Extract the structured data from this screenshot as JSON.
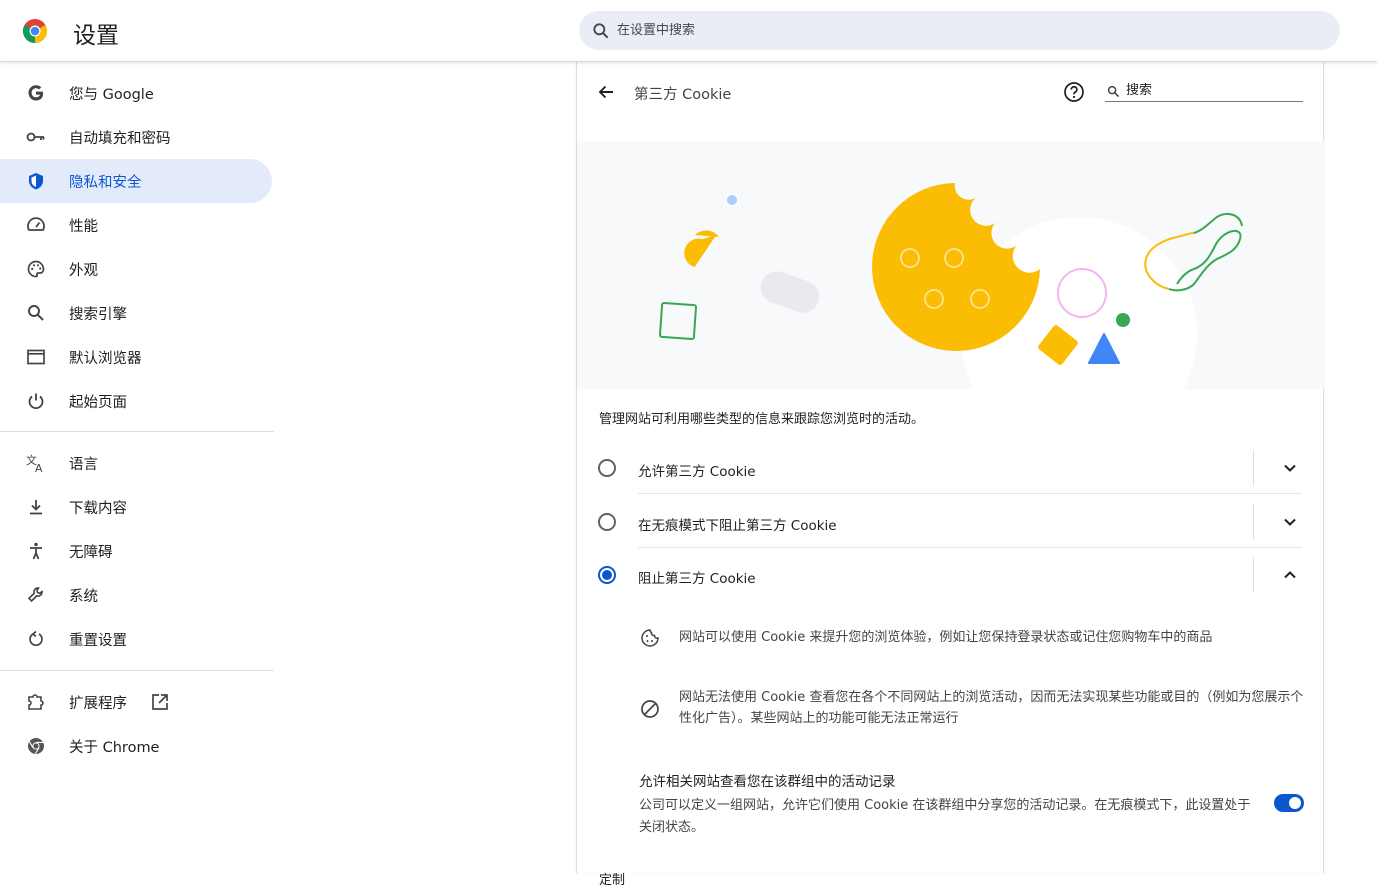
{
  "app": {
    "title": "设置"
  },
  "search": {
    "placeholder": "在设置中搜索"
  },
  "sidebar": {
    "items": [
      {
        "label": "您与 Google",
        "icon": "google-g-icon"
      },
      {
        "label": "自动填充和密码",
        "icon": "key-icon"
      },
      {
        "label": "隐私和安全",
        "icon": "shield-icon",
        "active": true
      },
      {
        "label": "性能",
        "icon": "speedometer-icon"
      },
      {
        "label": "外观",
        "icon": "palette-icon"
      },
      {
        "label": "搜索引擎",
        "icon": "search-icon"
      },
      {
        "label": "默认浏览器",
        "icon": "browser-window-icon"
      },
      {
        "label": "起始页面",
        "icon": "power-icon"
      },
      {
        "label": "语言",
        "icon": "translate-icon"
      },
      {
        "label": "下载内容",
        "icon": "download-icon"
      },
      {
        "label": "无障碍",
        "icon": "accessibility-icon"
      },
      {
        "label": "系统",
        "icon": "wrench-icon"
      },
      {
        "label": "重置设置",
        "icon": "reset-icon"
      },
      {
        "label": "扩展程序",
        "icon": "puzzle-icon",
        "external": true
      },
      {
        "label": "关于 Chrome",
        "icon": "chrome-icon"
      }
    ]
  },
  "page": {
    "title": "第三方 Cookie",
    "search_placeholder": "搜索",
    "description": "管理网站可利用哪些类型的信息来跟踪您浏览时的活动。",
    "options": [
      {
        "label": "允许第三方 Cookie",
        "selected": false,
        "expanded": false
      },
      {
        "label": "在无痕模式下阻止第三方 Cookie",
        "selected": false,
        "expanded": false
      },
      {
        "label": "阻止第三方 Cookie",
        "selected": true,
        "expanded": true
      }
    ],
    "details": [
      {
        "icon": "cookie-icon",
        "text": "网站可以使用 Cookie 来提升您的浏览体验，例如让您保持登录状态或记住您购物车中的商品"
      },
      {
        "icon": "block-icon",
        "text": "网站无法使用 Cookie 查看您在各个不同网站上的浏览活动，因而无法实现某些功能或目的（例如为您展示个性化广告）。某些网站上的功能可能无法正常运行"
      }
    ],
    "related_sites": {
      "title": "允许相关网站查看您在该群组中的活动记录",
      "description": "公司可以定义一组网站，允许它们使用 Cookie 在该群组中分享您的活动记录。在无痕模式下，此设置处于关闭状态。",
      "enabled": true
    },
    "next_section_cut": "定制"
  },
  "colors": {
    "accent": "#0b57d0",
    "active_bg": "#e3ebfa",
    "cookie": "#fbbc04",
    "green": "#34a853",
    "blue": "#4285f4",
    "pink": "#f4b4f4"
  }
}
